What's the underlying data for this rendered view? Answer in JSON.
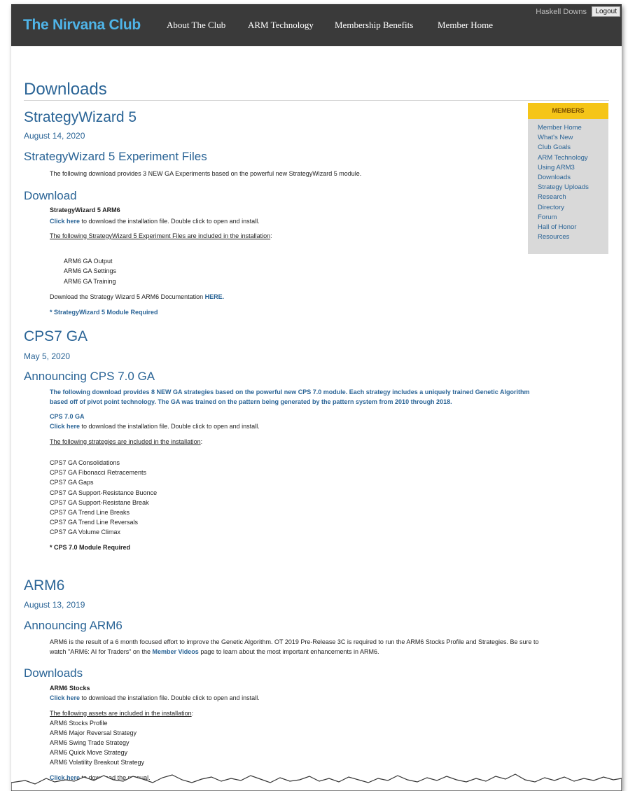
{
  "header": {
    "brand": "The Nirvana Club",
    "nav": [
      "About The Club",
      "ARM Technology",
      "Membership Benefits",
      "Member Home"
    ],
    "user_name": "Haskell Downs",
    "logout_label": "Logout"
  },
  "page": {
    "title": "Downloads"
  },
  "sidebar": {
    "title": "MEMBERS",
    "items": [
      "Member Home",
      "What's New",
      "Club Goals",
      "ARM Technology",
      "Using ARM3",
      "Downloads",
      "Strategy Uploads",
      "Research",
      "Directory",
      "Forum",
      "Hall of Honor",
      "Resources"
    ]
  },
  "sw5": {
    "title": "StrategyWizard 5",
    "date": "August 14, 2020",
    "sub1": "StrategyWizard 5 Experiment Files",
    "intro": "The following download provides 3 NEW GA Experiments based on the powerful new StrategyWizard 5 module.",
    "sub2": "Download",
    "pkg_name": "StrategyWizard 5 ARM6",
    "click_here": "Click here",
    "click_rest": " to download the installation file. Double click to open and install.",
    "included": "The following StrategyWizard 5 Experiment Files are included in the installation",
    "colon": ":",
    "files": [
      "ARM6 GA Output",
      "ARM6 GA Settings",
      "ARM6 GA Training"
    ],
    "doc_text": "Download the Strategy Wizard 5 ARM6 Documentation ",
    "doc_link": "HERE.",
    "required": "* StrategyWizard 5 Module Required"
  },
  "cps7": {
    "title": "CPS7 GA",
    "date": "May 5, 2020",
    "sub1": "Announcing CPS 7.0 GA",
    "intro_line1": "The following download provides 8 NEW GA strategies based on the powerful new CPS 7.0 module. Each strategy includes a uniquely trained Genetic Algorithm",
    "intro_line2": "based off of pivot point technology. The GA was trained on the pattern being generated by the pattern system from 2010 through 2018.",
    "pkg_name": "CPS 7.0 GA",
    "click_here": "Click here",
    "click_rest": " to download the installation file. Double click to open and install.",
    "included": "The following strategies are included in the installation",
    "colon": ":",
    "strategies": [
      "CPS7 GA Consolidations",
      "CPS7 GA Fibonacci Retracements",
      "CPS7 GA Gaps",
      "CPS7 GA Support-Resistance Buonce",
      "CPS7 GA Support-Resistane Break",
      "CPS7 GA Trend Line Breaks",
      "CPS7 GA Trend Line Reversals",
      "CPS7 GA Volume Climax"
    ],
    "required": "* CPS 7.0 Module Required"
  },
  "arm6": {
    "title": "ARM6",
    "date": "August 13, 2019",
    "sub1": "Announcing ARM6",
    "intro_line1": "ARM6 is the result of a 6 month focused effort to improve the Genetic Algorithm. OT 2019 Pre-Release 3C is required to run the ARM6 Stocks Profile and Strategies. Be sure to",
    "intro_line2_a": "watch \"ARM6: AI for Traders\" on the ",
    "intro_link": "Member Videos",
    "intro_line2_b": " page to learn about the most important enhancements in ARM6.",
    "sub2": "Downloads",
    "pkg_name": "ARM6 Stocks",
    "click_here": "Click here",
    "click_rest": " to download the installation file. Double click to open and install.",
    "included": "The following assets are included in the installation",
    "colon": ":",
    "assets": [
      "ARM6 Stocks Profile",
      "ARM6 Major Reversal Strategy",
      "ARM6 Swing Trade Strategy",
      "ARM6 Quick Move Strategy",
      "ARM6 Volatility Breakout Strategy"
    ],
    "manual_link": "Click here",
    "manual_rest": " to download the manual."
  }
}
